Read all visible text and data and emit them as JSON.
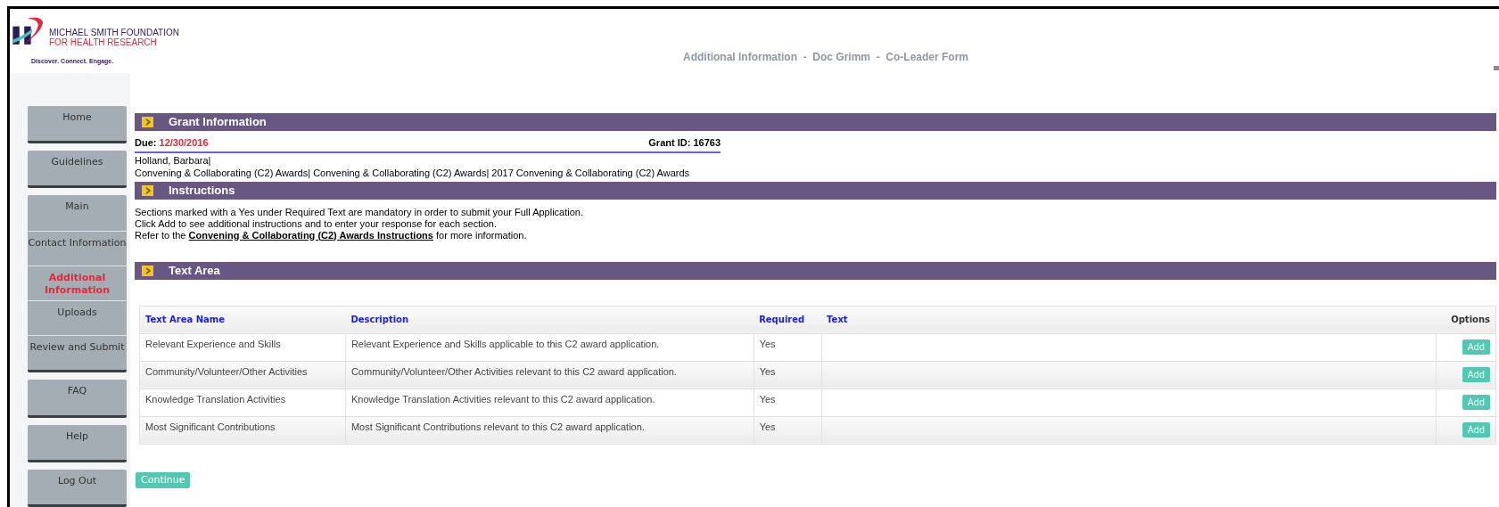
{
  "logo": {
    "line_1": "MICHAEL SMITH FOUNDATION",
    "line_2": "FOR HEALTH RESEARCH",
    "tagline": "Discover. Connect. Engage."
  },
  "header": {
    "title_parts": [
      "Additional Information",
      "Doc Grimm",
      "Co-Leader Form"
    ],
    "separator": "-"
  },
  "sidebar": {
    "groups": [
      {
        "items": [
          {
            "label": "Home",
            "selected": false
          }
        ]
      },
      {
        "items": [
          {
            "label": "Guidelines",
            "selected": false
          }
        ]
      },
      {
        "items": [
          {
            "label": "Main",
            "selected": false
          },
          {
            "label": "Contact Information",
            "selected": false
          },
          {
            "label": "Additional Information",
            "selected": true
          },
          {
            "label": "Uploads",
            "selected": false
          },
          {
            "label": "Review and Submit",
            "selected": false
          }
        ]
      },
      {
        "items": [
          {
            "label": "FAQ",
            "selected": false
          }
        ]
      },
      {
        "items": [
          {
            "label": "Help",
            "selected": false
          }
        ]
      },
      {
        "items": [
          {
            "label": "Log Out",
            "selected": false
          }
        ]
      }
    ]
  },
  "grant_information": {
    "title": "Grant Information",
    "due_label": "Due:",
    "due_date": "12/30/2016",
    "grant_id": "Grant ID: 16763",
    "applicant": "Holland, Barbara|",
    "program": "Convening & Collaborating (C2) Awards| Convening & Collaborating (C2) Awards| 2017 Convening & Collaborating (C2) Awards"
  },
  "instructions": {
    "title": "Instructions",
    "lines": [
      "Sections marked with a Yes under Required Text are mandatory in order to submit your Full Application.",
      "Click Add to see additional instructions and to enter your response for each section."
    ],
    "refer_before": "Refer to the",
    "refer_link": "Convening & Collaborating (C2) Awards Instructions",
    "refer_after": "for more information."
  },
  "text_area": {
    "title": "Text Area",
    "columns": [
      "Text Area Name",
      "Description",
      "Required",
      "Text",
      "Options"
    ],
    "rows": [
      {
        "name": "Relevant Experience and Skills",
        "description": "Relevant Experience and Skills applicable to this C2 award application.",
        "required": "Yes",
        "action": "Add"
      },
      {
        "name": "Community/Volunteer/Other Activities",
        "description": "Community/Volunteer/Other Activities relevant to this C2 award application.",
        "required": "Yes",
        "action": "Add"
      },
      {
        "name": "Knowledge Translation Activities",
        "description": "Knowledge Translation Activities relevant to this C2 award application.",
        "required": "Yes",
        "action": "Add"
      },
      {
        "name": "Most Significant Contributions",
        "description": "Most Significant Contributions relevant to this C2 award application.",
        "required": "Yes",
        "action": "Add"
      }
    ]
  },
  "continue_button": "Continue"
}
